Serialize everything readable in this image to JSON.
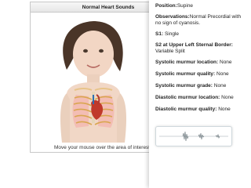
{
  "sim": {
    "title": "Normal Heart Sounds",
    "caption": "Move your mouse over the area of interest"
  },
  "info": {
    "position_label": "Position:",
    "position_value": "Supine",
    "observations_label": "Observations:",
    "observations_value": "Normal Precordial with no sign of cyanosis.",
    "s1_label": "S1:",
    "s1_value": "Single",
    "s2_label": "S2 at Upper Left Sternal Border:",
    "s2_value": "Variable Split",
    "sys_loc_label": "Systolic murmur location:",
    "sys_loc_value": "None",
    "sys_qual_label": "Systolic murmur quality:",
    "sys_qual_value": "None",
    "sys_grade_label": "Systolic murmur grade:",
    "sys_grade_value": "None",
    "dia_loc_label": "Diastolic murmur location:",
    "dia_loc_value": "None",
    "dia_qual_label": "Diastolic murmur quality:",
    "dia_qual_value": "None"
  },
  "colors": {
    "accent": "#1f6fb2",
    "waveform": "#7f8c8d"
  }
}
